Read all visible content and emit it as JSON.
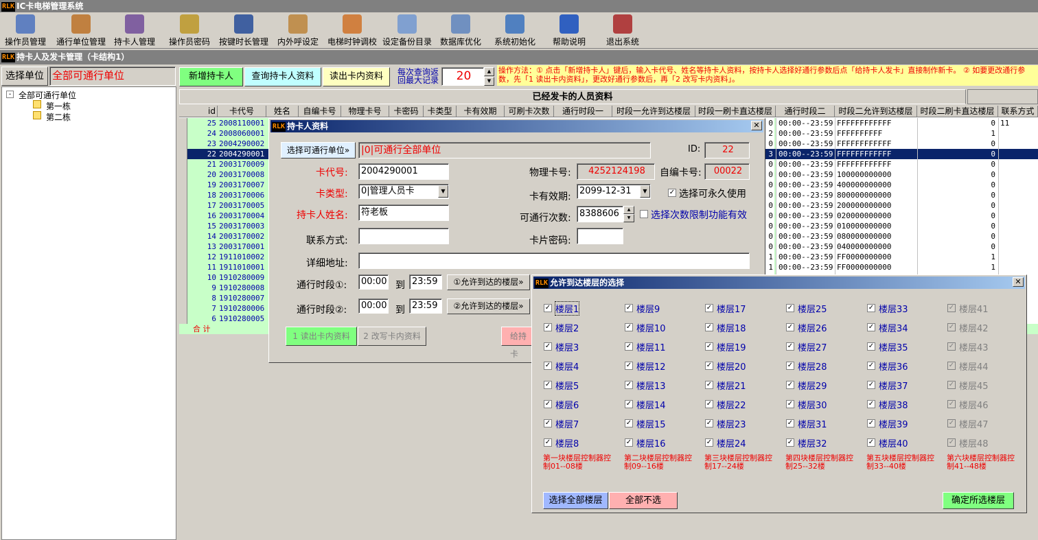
{
  "app_title": "IC卡电梯管理系统",
  "logo_text": "RLK",
  "toolbar": [
    "操作员管理",
    "通行单位管理",
    "持卡人管理",
    "操作员密码",
    "按键时长管理",
    "内外呼设定",
    "电梯时钟调校",
    "设定备份目录",
    "数据库优化",
    "系统初始化",
    "帮助说明",
    "退出系统"
  ],
  "subtitle": "持卡人及发卡管理（卡结构1）",
  "select_unit_btn": "选择单位",
  "current_unit": "全部可通行单位",
  "new_holder_btn": "新增持卡人",
  "query_btn": "查询持卡人资料",
  "read_card_btn": "读出卡内资料",
  "max_label": "每次查询返回最大记录",
  "max_value": "20",
  "instruction": "操作方法：① 点击「新增持卡人」键后，输入卡代号、姓名等持卡人资料，按持卡人选择好通行参数后点「给持卡人发卡」直接制作新卡。 ② 如要更改通行参数，先「1 读出卡内资料」，更改好通行参数后，再「2 改写卡内资料」。",
  "tree": {
    "root": "全部可通行单位",
    "children": [
      "第一栋",
      "第二栋"
    ]
  },
  "grid_title": "已经发卡的人员资料",
  "headers": [
    "id",
    "卡代号",
    "姓名",
    "自编卡号",
    "物理卡号",
    "卡密码",
    "卡类型",
    "卡有效期",
    "可刷卡次数",
    "通行时段一",
    "时段一允许到达楼层",
    "时段一刷卡直达楼层",
    "通行时段二",
    "时段二允许到达楼层",
    "时段二刷卡直达楼层",
    "联系方式"
  ],
  "rows": [
    {
      "id": "25",
      "code": "2008110001",
      "f": "0",
      "time": "00:00--23:59",
      "floors": "FFFFFFFFFFFF",
      "direct": "0",
      "contact": "11"
    },
    {
      "id": "24",
      "code": "2008060001",
      "f": "2",
      "time": "00:00--23:59",
      "floors": "FFFFFFFFFF",
      "direct": "1",
      "contact": ""
    },
    {
      "id": "23",
      "code": "2004290002",
      "f": "0",
      "time": "00:00--23:59",
      "floors": "FFFFFFFFFFFF",
      "direct": "0",
      "contact": ""
    },
    {
      "id": "22",
      "code": "2004290001",
      "f": "3",
      "time": "00:00--23:59",
      "floors": "FFFFFFFFFFFF",
      "direct": "0",
      "contact": ""
    },
    {
      "id": "21",
      "code": "2003170009",
      "f": "0",
      "time": "00:00--23:59",
      "floors": "FFFFFFFFFFFF",
      "direct": "0",
      "contact": ""
    },
    {
      "id": "20",
      "code": "2003170008",
      "f": "0",
      "time": "00:00--23:59",
      "floors": "100000000000",
      "direct": "0",
      "contact": ""
    },
    {
      "id": "19",
      "code": "2003170007",
      "f": "0",
      "time": "00:00--23:59",
      "floors": "400000000000",
      "direct": "0",
      "contact": ""
    },
    {
      "id": "18",
      "code": "2003170006",
      "f": "0",
      "time": "00:00--23:59",
      "floors": "800000000000",
      "direct": "0",
      "contact": ""
    },
    {
      "id": "17",
      "code": "2003170005",
      "f": "0",
      "time": "00:00--23:59",
      "floors": "200000000000",
      "direct": "0",
      "contact": ""
    },
    {
      "id": "16",
      "code": "2003170004",
      "f": "0",
      "time": "00:00--23:59",
      "floors": "020000000000",
      "direct": "0",
      "contact": ""
    },
    {
      "id": "15",
      "code": "2003170003",
      "f": "0",
      "time": "00:00--23:59",
      "floors": "010000000000",
      "direct": "0",
      "contact": ""
    },
    {
      "id": "14",
      "code": "2003170002",
      "f": "0",
      "time": "00:00--23:59",
      "floors": "080000000000",
      "direct": "0",
      "contact": ""
    },
    {
      "id": "13",
      "code": "2003170001",
      "f": "0",
      "time": "00:00--23:59",
      "floors": "040000000000",
      "direct": "0",
      "contact": ""
    },
    {
      "id": "12",
      "code": "1911010002",
      "f": "1",
      "time": "00:00--23:59",
      "floors": "FF0000000000",
      "direct": "1",
      "contact": ""
    },
    {
      "id": "11",
      "code": "1911010001",
      "f": "1",
      "time": "00:00--23:59",
      "floors": "FF0000000000",
      "direct": "1",
      "contact": ""
    },
    {
      "id": "10",
      "code": "1910280009",
      "f": "",
      "time": "",
      "floors": "",
      "direct": "",
      "contact": ""
    },
    {
      "id": "9",
      "code": "1910280008",
      "f": "",
      "time": "",
      "floors": "",
      "direct": "",
      "contact": ""
    },
    {
      "id": "8",
      "code": "1910280007",
      "f": "",
      "time": "",
      "floors": "",
      "direct": "",
      "contact": ""
    },
    {
      "id": "7",
      "code": "1910280006",
      "f": "",
      "time": "",
      "floors": "",
      "direct": "",
      "contact": ""
    },
    {
      "id": "6",
      "code": "1910280005",
      "f": "",
      "time": "",
      "floors": "",
      "direct": "",
      "contact": ""
    }
  ],
  "total_label": "合 计",
  "holder": {
    "title": "持卡人资料",
    "select_btn": "选择可通行单位»",
    "unit_value": "|0|可通行全部单位",
    "id_label": "ID:",
    "id_value": "22",
    "code_label": "卡代号:",
    "code_value": "2004290001",
    "phys_label": "物理卡号:",
    "phys_value": "4252124198",
    "self_label": "自编卡号:",
    "self_value": "00022",
    "type_label": "卡类型:",
    "type_value": "0|管理人员卡",
    "expire_label": "卡有效期:",
    "expire_value": "2099-12-31",
    "perm_label": "选择可永久使用",
    "name_label": "持卡人姓名:",
    "name_value": "符老板",
    "count_label": "可通行次数:",
    "count_value": "8388606",
    "count_limit_label": "选择次数限制功能有效",
    "contact_label": "联系方式:",
    "pwd_label": "卡片密码:",
    "addr_label": "详细地址:",
    "t1_label": "通行时段①:",
    "t1_from": "00:00",
    "to_label": "到",
    "t1_to": "23:59",
    "t1_btn": "①允许到达的楼层»",
    "t2_label": "通行时段②:",
    "t2_from": "00:00",
    "t2_to": "23:59",
    "t2_btn": "②允许到达的楼层»",
    "read_btn": "1 读出卡内资料",
    "write_btn": "2 改写卡内资料",
    "issue_btn": "给持卡"
  },
  "floor": {
    "title": "允许到达楼层的选择",
    "floors": [
      "楼层1",
      "楼层2",
      "楼层3",
      "楼层4",
      "楼层5",
      "楼层6",
      "楼层7",
      "楼层8",
      "楼层9",
      "楼层10",
      "楼层11",
      "楼层12",
      "楼层13",
      "楼层14",
      "楼层15",
      "楼层16",
      "楼层17",
      "楼层18",
      "楼层19",
      "楼层20",
      "楼层21",
      "楼层22",
      "楼层23",
      "楼层24",
      "楼层25",
      "楼层26",
      "楼层27",
      "楼层28",
      "楼层29",
      "楼层30",
      "楼层31",
      "楼层32",
      "楼层33",
      "楼层34",
      "楼层35",
      "楼层36",
      "楼层37",
      "楼层38",
      "楼层39",
      "楼层40",
      "楼层41",
      "楼层42",
      "楼层43",
      "楼层44",
      "楼层45",
      "楼层46",
      "楼层47",
      "楼层48"
    ],
    "notes": [
      "第一块楼层控制器控制01--08楼",
      "第二块楼层控制器控制09--16楼",
      "第三块楼层控制器控制17--24楼",
      "第四块楼层控制器控制25--32楼",
      "第五块楼层控制器控制33--40楼",
      "第六块楼层控制器控制41--48楼"
    ],
    "select_all": "选择全部楼层",
    "select_none": "全部不选",
    "confirm": "确定所选楼层"
  }
}
